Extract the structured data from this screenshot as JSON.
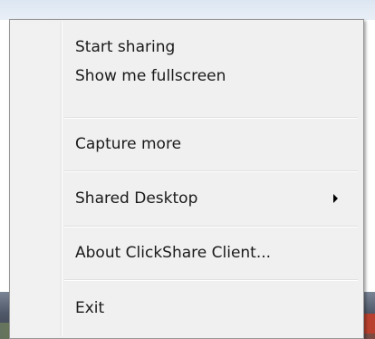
{
  "menu": {
    "items": [
      {
        "label": "Start sharing"
      },
      {
        "label": "Show me fullscreen"
      },
      {
        "label": "Capture more"
      },
      {
        "label": "Shared Desktop",
        "has_submenu": true
      },
      {
        "label": "About ClickShare Client..."
      },
      {
        "label": "Exit"
      }
    ]
  },
  "colors": {
    "menu_background": "#f0f0f0",
    "menu_border": "#979797",
    "text": "#1a1a1a"
  }
}
